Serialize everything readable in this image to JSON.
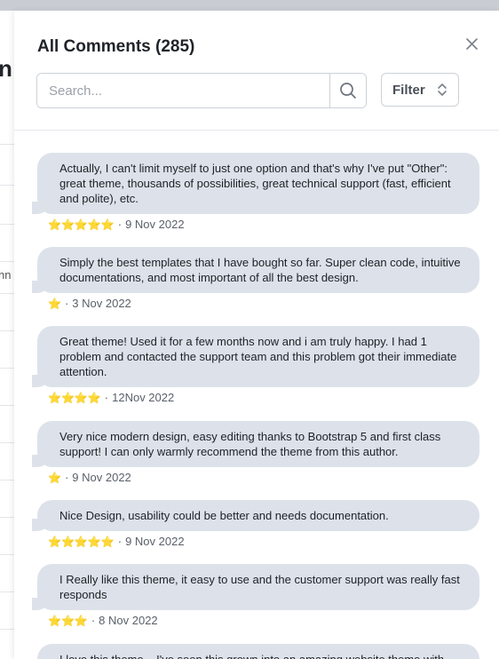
{
  "drawer": {
    "title": "All Comments (285)",
    "search_placeholder": "Search...",
    "filter_label": "Filter"
  },
  "background": {
    "partial_text_1": "n",
    "partial_text_2": "nn"
  },
  "comments": [
    {
      "text": "Actually, I can't limit myself to just one option and that's why I've put \"Other\": great theme, thousands of possibilities, great technical support (fast, efficient and polite), etc.",
      "stars": "⭐⭐⭐⭐⭐",
      "separator": "·",
      "date": "9 Nov 2022"
    },
    {
      "text": "Simply the best templates that I have bought so far. Super clean code, intuitive documentations, and most important of all the best design.",
      "stars": "⭐",
      "separator": "·",
      "date": "3 Nov 2022"
    },
    {
      "text": "Great theme! Used it for a few months now and i am truly happy. I had 1 problem and contacted the support team and this problem got their immediate attention.",
      "stars": "⭐⭐⭐⭐",
      "separator": "·",
      "date": "12Nov 2022"
    },
    {
      "text": "Very nice modern design, easy editing thanks to Bootstrap 5 and first class support! I can only warmly recommend the theme from this author.",
      "stars": "⭐",
      "separator": "·",
      "date": "9 Nov 2022"
    },
    {
      "text": "Nice Design, usability could be better and needs documentation.",
      "stars": "⭐⭐⭐⭐⭐",
      "separator": "·",
      "date": "9 Nov 2022"
    },
    {
      "text": "I Really like this theme, it easy to use and the customer support was really fast responds",
      "stars": "⭐⭐⭐",
      "separator": "·",
      "date": "8 Nov 2022"
    },
    {
      "text": "I love this theme... I've seen this grown into an amazing website theme with",
      "stars": "",
      "separator": "",
      "date": ""
    }
  ]
}
